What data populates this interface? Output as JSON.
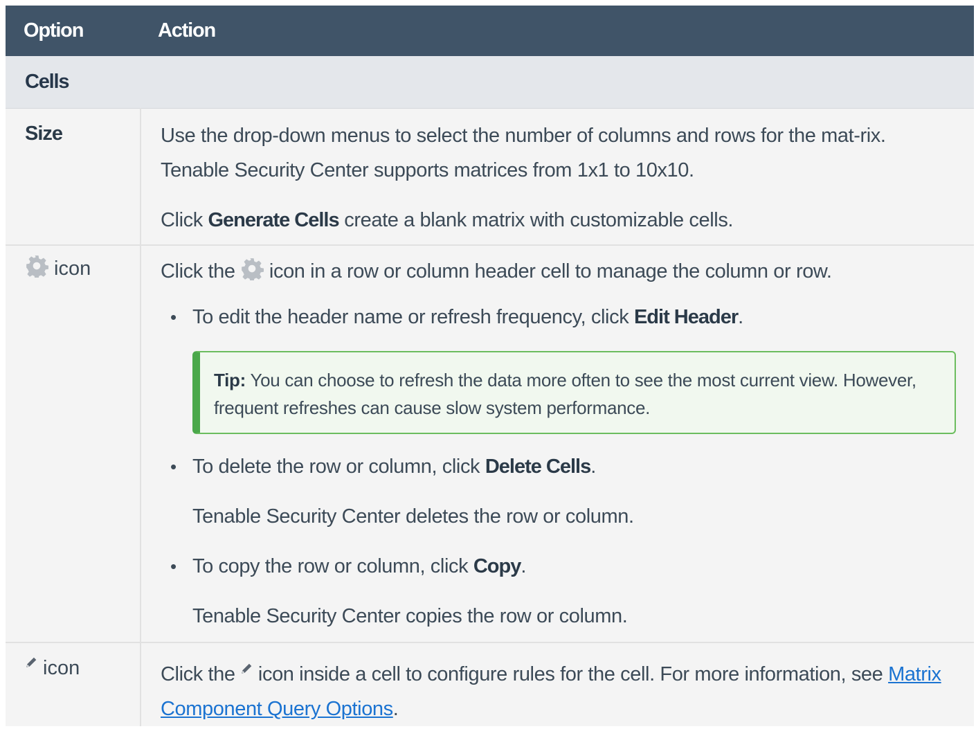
{
  "header": {
    "col1": "Option",
    "col2": "Action"
  },
  "section": {
    "label": "Cells"
  },
  "rows": {
    "size": {
      "option": "Size",
      "para1": "Use the drop-down menus to select the number of columns and rows for the mat-rix. Tenable Security Center supports matrices from 1x1 to 10x10.",
      "para2_pre": "Click ",
      "para2_bold": "Generate Cells",
      "para2_post": " create a blank matrix with customizable cells."
    },
    "gear": {
      "option_suffix": " icon",
      "intro_pre": "Click the ",
      "intro_post": " icon in a row or column header cell to manage the column or row.",
      "bullet1_pre": "To edit the header name or refresh frequency, click ",
      "bullet1_bold": "Edit Header",
      "bullet1_post": ".",
      "tip_label": "Tip:",
      "tip_text": " You can choose to refresh the data more often to see the most current view. However, frequent refreshes can cause slow system performance.",
      "bullet2_pre": "To delete the row or column, click ",
      "bullet2_bold": "Delete Cells",
      "bullet2_post": ".",
      "bullet2_sub": "Tenable Security Center deletes the row or column.",
      "bullet3_pre": "To copy the row or column, click ",
      "bullet3_bold": "Copy",
      "bullet3_post": ".",
      "bullet3_sub": "Tenable Security Center copies the row or column."
    },
    "pencil": {
      "option_suffix": " icon",
      "text_pre": "Click the ",
      "text_mid": " icon inside a cell to configure rules for the cell. For more information, see ",
      "link": "Matrix Component Query Options",
      "text_post": "."
    }
  },
  "icons": {
    "gear": "gear-icon",
    "pencil": "pencil-icon"
  },
  "colors": {
    "header_bg": "#405468",
    "section_bg": "#e4e7eb",
    "tip_border": "#4aa84a",
    "link": "#1b73d1"
  }
}
